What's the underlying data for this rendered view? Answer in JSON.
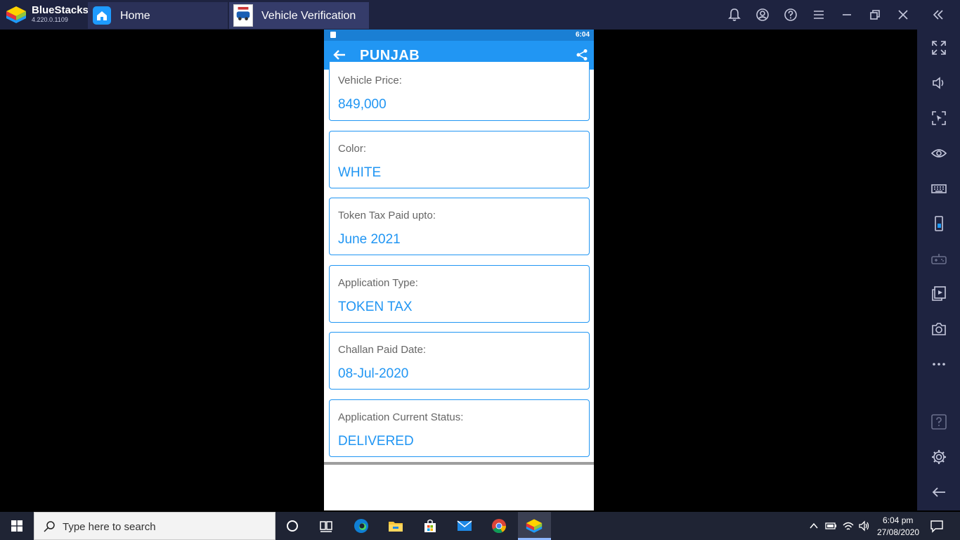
{
  "bluestacks": {
    "name": "BlueStacks",
    "version": "4.220.0.1109",
    "tabs": [
      {
        "label": "Home"
      },
      {
        "label": "Vehicle Verification"
      }
    ],
    "top_icons": [
      "bell-icon",
      "account-icon",
      "help-icon",
      "menu-icon",
      "minimize-icon",
      "restore-icon",
      "close-icon",
      "collapse-icon"
    ],
    "sidebar_icons": [
      "fullscreen-icon",
      "volume-icon",
      "cursor-lock-icon",
      "eye-icon",
      "keyboard-icon",
      "rotate-icon",
      "gamepad-icon",
      "media-icon",
      "camera-icon",
      "more-icon",
      "help-icon",
      "settings-icon",
      "back-icon"
    ]
  },
  "phone": {
    "status_time": "6:04",
    "appbar_title": "PUNJAB",
    "fields": [
      {
        "label": "Vehicle Price:",
        "value": "849,000"
      },
      {
        "label": "Color:",
        "value": "WHITE"
      },
      {
        "label": "Token Tax Paid upto:",
        "value": "June 2021"
      },
      {
        "label": "Application Type:",
        "value": "TOKEN TAX"
      },
      {
        "label": "Challan Paid Date:",
        "value": "08-Jul-2020"
      },
      {
        "label": "Application Current Status:",
        "value": "DELIVERED"
      }
    ]
  },
  "taskbar": {
    "search_placeholder": "Type here to search",
    "apps": [
      "cortana-icon",
      "task-view-icon",
      "edge-icon",
      "file-explorer-icon",
      "store-icon",
      "mail-icon",
      "chrome-icon",
      "bluestacks-icon"
    ],
    "clock_time": "6:04 pm",
    "clock_date": "27/08/2020"
  },
  "colors": {
    "accent": "#2196f3",
    "titlebar": "#1e2340",
    "label_gray": "#666666"
  }
}
